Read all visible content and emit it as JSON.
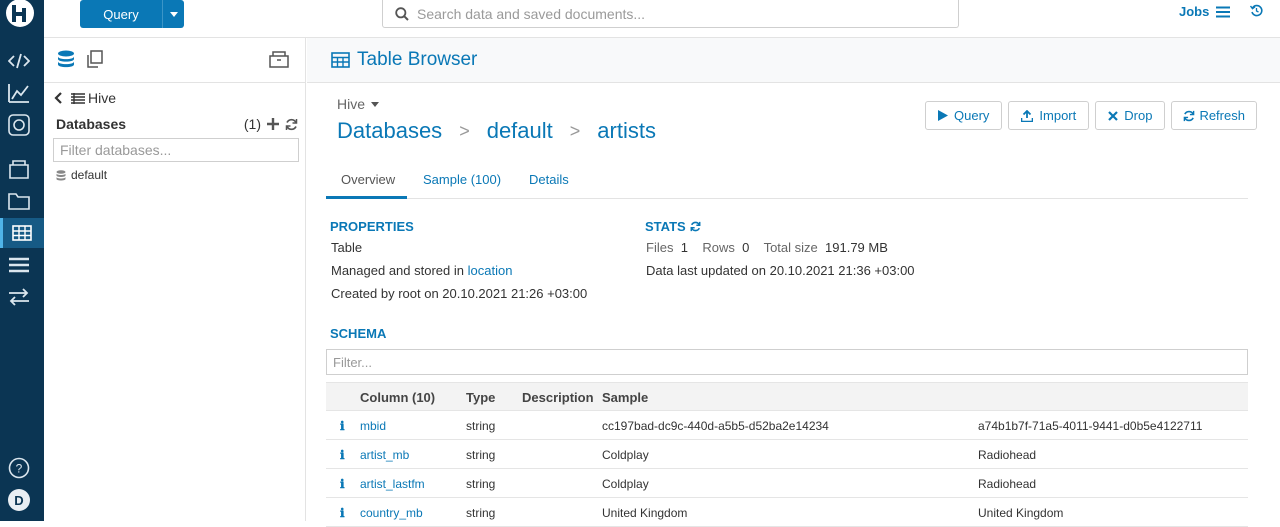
{
  "topbar": {
    "query_label": "Query",
    "search_placeholder": "Search data and saved documents...",
    "jobs_label": "Jobs"
  },
  "leftnav": {
    "avatar_letter": "D"
  },
  "sidepanel": {
    "crumb": "Hive",
    "databases_label": "Databases",
    "db_count": "(1)",
    "filter_placeholder": "Filter databases...",
    "items": [
      {
        "label": "default"
      }
    ]
  },
  "main": {
    "title": "Table Browser",
    "source": "Hive",
    "breadcrumb": {
      "root": "Databases",
      "sep1": ">",
      "db": "default",
      "sep2": ">",
      "table": "artists"
    },
    "actions": {
      "query": "Query",
      "import": "Import",
      "drop": "Drop",
      "refresh": "Refresh"
    },
    "tabs": [
      {
        "label": "Overview"
      },
      {
        "label": "Sample (100)"
      },
      {
        "label": "Details"
      }
    ],
    "properties": {
      "title": "PROPERTIES",
      "kind": "Table",
      "managed_prefix": "Managed and stored in",
      "managed_link": "location",
      "created": "Created by root on 20.10.2021 21:26 +03:00"
    },
    "stats": {
      "title": "STATS",
      "files_label": "Files",
      "files": "1",
      "rows_label": "Rows",
      "rows": "0",
      "size_label": "Total size",
      "size": "191.79 MB",
      "updated": "Data last updated on 20.10.2021 21:36 +03:00"
    },
    "schema": {
      "title": "SCHEMA",
      "filter_placeholder": "Filter...",
      "headers": {
        "column": "Column (10)",
        "type": "Type",
        "description": "Description",
        "sample": "Sample"
      },
      "rows": [
        {
          "name": "mbid",
          "type": "string",
          "description": "",
          "sample1": "cc197bad-dc9c-440d-a5b5-d52ba2e14234",
          "sample2": "a74b1b7f-71a5-4011-9441-d0b5e4122711"
        },
        {
          "name": "artist_mb",
          "type": "string",
          "description": "",
          "sample1": "Coldplay",
          "sample2": "Radiohead"
        },
        {
          "name": "artist_lastfm",
          "type": "string",
          "description": "",
          "sample1": "Coldplay",
          "sample2": "Radiohead"
        },
        {
          "name": "country_mb",
          "type": "string",
          "description": "",
          "sample1": "United Kingdom",
          "sample2": "United Kingdom"
        }
      ]
    }
  },
  "colors": {
    "accent": "#0a78b6",
    "nav_bg": "#0b3553"
  }
}
